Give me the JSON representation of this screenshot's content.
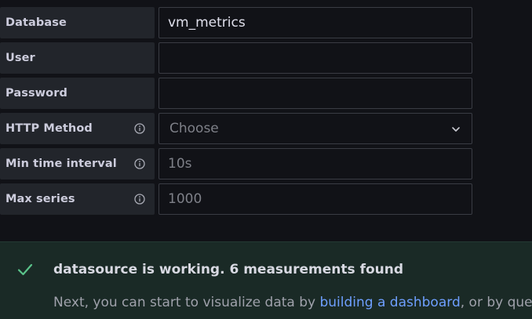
{
  "form": {
    "database": {
      "label": "Database",
      "value": "vm_metrics"
    },
    "user": {
      "label": "User",
      "value": ""
    },
    "password": {
      "label": "Password",
      "value": ""
    },
    "http_method": {
      "label": "HTTP Method",
      "selected": "Choose"
    },
    "min_time_interval": {
      "label": "Min time interval",
      "placeholder": "10s"
    },
    "max_series": {
      "label": "Max series",
      "placeholder": "1000"
    }
  },
  "status": {
    "title": "datasource is working. 6 measurements found",
    "text_before": "Next, you can start to visualize data by ",
    "link_text": "building a dashboard",
    "text_after": ", or by query"
  },
  "colors": {
    "success": "#5ac38a",
    "link": "#6e9fff",
    "label_bg": "#22252b",
    "page_bg": "#111217"
  },
  "icons": {
    "info": "info-circle-icon",
    "chevron": "chevron-down-icon",
    "check": "check-icon"
  }
}
